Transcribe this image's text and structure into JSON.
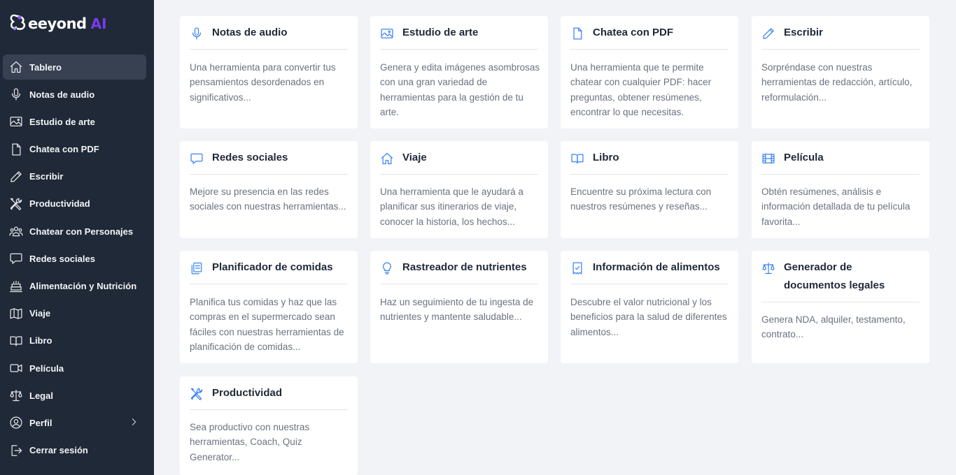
{
  "brand": {
    "name": "eeyond",
    "suffix": "AI",
    "accent": "#7c3aed"
  },
  "colors": {
    "sidebar_bg": "#1f2937",
    "active_bg": "#374151",
    "icon_blue": "#3b82f6",
    "page_bg": "#f1f3f6"
  },
  "sidebar": {
    "items": [
      {
        "label": "Tablero",
        "icon": "home-icon"
      },
      {
        "label": "Notas de audio",
        "icon": "microphone-icon"
      },
      {
        "label": "Estudio de arte",
        "icon": "image-icon"
      },
      {
        "label": "Chatea con PDF",
        "icon": "document-icon"
      },
      {
        "label": "Escribir",
        "icon": "pencil-icon"
      },
      {
        "label": "Productividad",
        "icon": "tools-icon"
      },
      {
        "label": "Chatear con Personajes",
        "icon": "users-icon"
      },
      {
        "label": "Redes sociales",
        "icon": "chat-bubble-icon"
      },
      {
        "label": "Alimentación y Nutrición",
        "icon": "cake-icon"
      },
      {
        "label": "Viaje",
        "icon": "map-icon"
      },
      {
        "label": "Libro",
        "icon": "book-icon"
      },
      {
        "label": "Película",
        "icon": "video-icon"
      },
      {
        "label": "Legal",
        "icon": "scale-icon"
      },
      {
        "label": "Perfil",
        "icon": "user-circle-icon"
      },
      {
        "label": "Cerrar sesión",
        "icon": "logout-icon"
      }
    ]
  },
  "cards": [
    {
      "title": "Notas de audio",
      "icon": "microphone-icon",
      "description": "Una herramienta para convertir tus pensamientos desordenados en significativos..."
    },
    {
      "title": "Estudio de arte",
      "icon": "image-icon",
      "description": "Genera y edita imágenes asombrosas con una gran variedad de herramientas para la gestión de tu arte."
    },
    {
      "title": "Chatea con PDF",
      "icon": "document-icon",
      "description": "Una herramienta que te permite chatear con cualquier PDF: hacer preguntas, obtener resúmenes, encontrar lo que necesitas."
    },
    {
      "title": "Escribir",
      "icon": "pencil-icon",
      "description": "Sorpréndase con nuestras herramientas de redacción, artículo, reformulación..."
    },
    {
      "title": "Redes sociales",
      "icon": "chat-bubble-icon",
      "description": "Mejore su presencia en las redes sociales con nuestras herramientas..."
    },
    {
      "title": "Viaje",
      "icon": "home-icon",
      "description": "Una herramienta que le ayudará a planificar sus itinerarios de viaje, conocer la historia, los hechos..."
    },
    {
      "title": "Libro",
      "icon": "book-icon",
      "description": "Encuentre su próxima lectura con nuestros resúmenes y reseñas..."
    },
    {
      "title": "Película",
      "icon": "film-icon",
      "description": "Obtén resúmenes, análisis e información detallada de tu película favorita..."
    },
    {
      "title": "Planificador de comidas",
      "icon": "clipboard-icon",
      "description": "Planifica tus comidas y haz que las compras en el supermercado sean fáciles con nuestras herramientas de planificación de comidas..."
    },
    {
      "title": "Rastreador de nutrientes",
      "icon": "lightbulb-icon",
      "description": "Haz un seguimiento de tu ingesta de nutrientes y mantente saludable..."
    },
    {
      "title": "Información de alimentos",
      "icon": "receipt-icon",
      "description": "Descubre el valor nutricional y los beneficios para la salud de diferentes alimentos..."
    },
    {
      "title": "Generador de documentos legales",
      "icon": "scale-icon",
      "description": "Genera NDA, alquiler, testamento, contrato..."
    },
    {
      "title": "Productividad",
      "icon": "tools-icon",
      "description": "Sea productivo con nuestras herramientas, Coach, Quiz Generator..."
    }
  ]
}
